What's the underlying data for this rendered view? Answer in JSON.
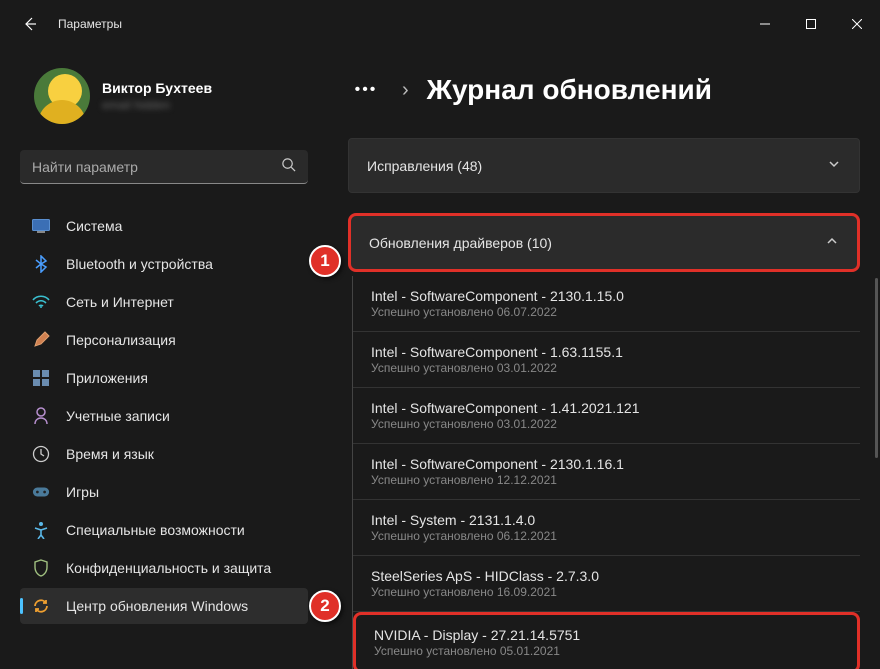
{
  "app": {
    "title": "Параметры"
  },
  "profile": {
    "name": "Виктор Бухтеев",
    "email": "email hidden"
  },
  "search": {
    "placeholder": "Найти параметр"
  },
  "nav": {
    "items": [
      {
        "label": "Система"
      },
      {
        "label": "Bluetooth и устройства"
      },
      {
        "label": "Сеть и Интернет"
      },
      {
        "label": "Персонализация"
      },
      {
        "label": "Приложения"
      },
      {
        "label": "Учетные записи"
      },
      {
        "label": "Время и язык"
      },
      {
        "label": "Игры"
      },
      {
        "label": "Специальные возможности"
      },
      {
        "label": "Конфиденциальность и защита"
      },
      {
        "label": "Центр обновления Windows"
      }
    ]
  },
  "breadcrumb": {
    "chevron": "›"
  },
  "page": {
    "title": "Журнал обновлений"
  },
  "sections": {
    "fixes": {
      "label": "Исправления (48)"
    },
    "drivers": {
      "label": "Обновления драйверов (10)"
    }
  },
  "updates": [
    {
      "title": "Intel - SoftwareComponent - 2130.1.15.0",
      "status": "Успешно установлено 06.07.2022"
    },
    {
      "title": "Intel - SoftwareComponent - 1.63.1155.1",
      "status": "Успешно установлено 03.01.2022"
    },
    {
      "title": "Intel - SoftwareComponent - 1.41.2021.121",
      "status": "Успешно установлено 03.01.2022"
    },
    {
      "title": "Intel - SoftwareComponent - 2130.1.16.1",
      "status": "Успешно установлено 12.12.2021"
    },
    {
      "title": "Intel - System - 2131.1.4.0",
      "status": "Успешно установлено 06.12.2021"
    },
    {
      "title": "SteelSeries ApS - HIDClass - 2.7.3.0",
      "status": "Успешно установлено 16.09.2021"
    },
    {
      "title": "NVIDIA - Display - 27.21.14.5751",
      "status": "Успешно установлено 05.01.2021"
    }
  ],
  "markers": {
    "m1": "1",
    "m2": "2"
  }
}
